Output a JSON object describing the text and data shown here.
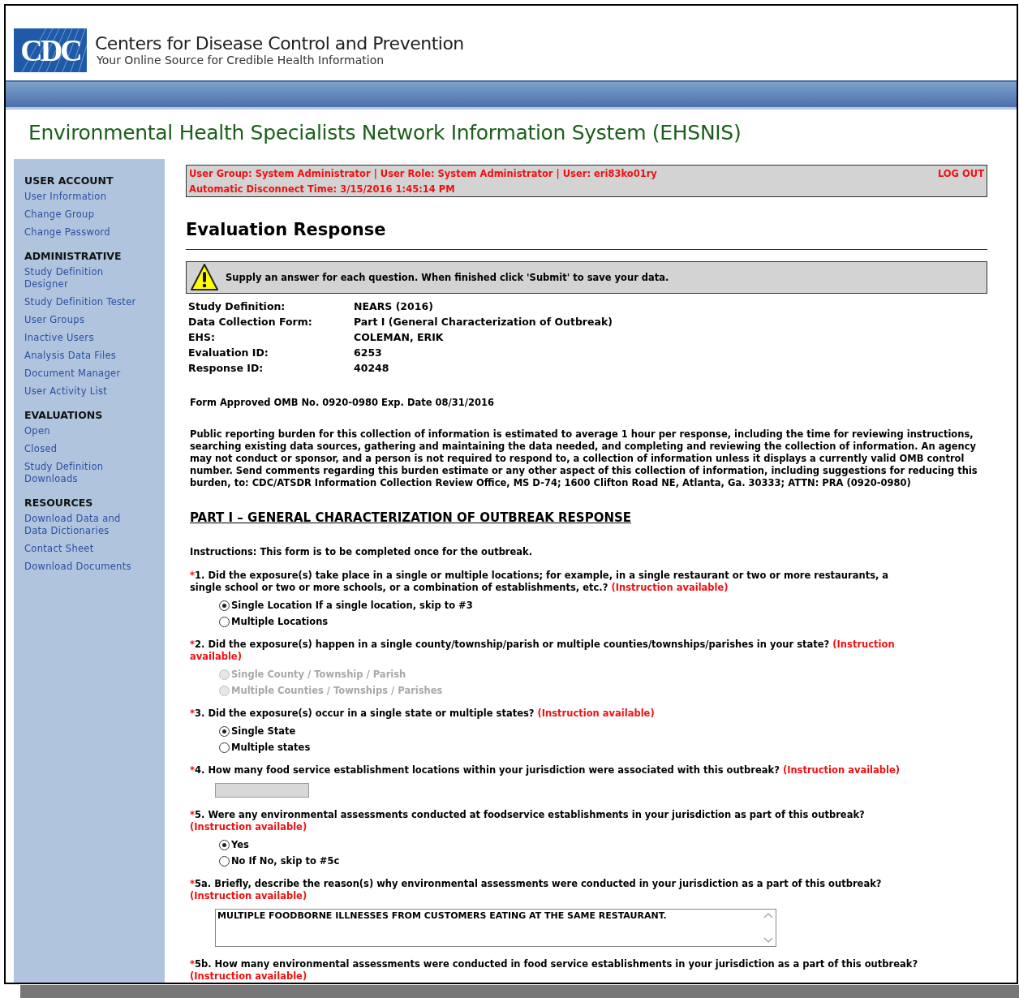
{
  "header": {
    "logo_text": "CDC",
    "title": "Centers for Disease Control and Prevention",
    "tagline": "Your Online Source for Credible Health Information"
  },
  "app_title": "Environmental Health Specialists Network Information System (EHSNIS)",
  "sidebar": [
    {
      "heading": "USER ACCOUNT",
      "items": [
        {
          "label": "User Information"
        },
        {
          "label": "Change Group"
        },
        {
          "label": "Change Password"
        }
      ]
    },
    {
      "heading": "ADMINISTRATIVE",
      "items": [
        {
          "label": "Study Definition Designer"
        },
        {
          "label": "Study Definition Tester"
        },
        {
          "label": "User Groups"
        },
        {
          "label": "Inactive Users"
        },
        {
          "label": "Analysis Data Files"
        },
        {
          "label": "Document Manager"
        },
        {
          "label": "User Activity List"
        }
      ]
    },
    {
      "heading": "EVALUATIONS",
      "items": [
        {
          "label": "Open"
        },
        {
          "label": "Closed"
        },
        {
          "label": "Study Definition Downloads"
        }
      ]
    },
    {
      "heading": "RESOURCES",
      "items": [
        {
          "label": "Download Data and Data Dictionaries"
        },
        {
          "label": "Contact Sheet"
        },
        {
          "label": "Download Documents"
        }
      ]
    }
  ],
  "status": {
    "user_line": "User Group: System Administrator | User Role: System Administrator | User: eri83ko01ry",
    "disconnect": "Automatic Disconnect Time: 3/15/2016 1:45:14 PM",
    "logout": "LOG OUT"
  },
  "page_title": "Evaluation Response",
  "notice": "Supply an answer for each question. When finished click 'Submit' to save your data.",
  "info": [
    {
      "label": "Study Definition:",
      "value": "NEARS (2016)"
    },
    {
      "label": "Data Collection Form:",
      "value": "Part I (General Characterization of Outbreak)"
    },
    {
      "label": "EHS:",
      "value": "COLEMAN, ERIK"
    },
    {
      "label": "Evaluation ID:",
      "value": "6253"
    },
    {
      "label": "Response ID:",
      "value": "40248"
    }
  ],
  "omb": "Form Approved OMB No. 0920-0980 Exp. Date 08/31/2016",
  "burden": "Public reporting burden for this collection of information is estimated to average 1 hour per response, including the time for reviewing instructions, searching existing data sources, gathering and maintaining the data needed, and completing and reviewing the collection of information. An agency may not conduct or sponsor, and a person is not required to respond to, a collection of information unless it displays a currently valid OMB control number. Send comments regarding this burden estimate or any other aspect of this collection of information, including suggestions for reducing this burden, to: CDC/ATSDR Information Collection Review Office, MS D-74; 1600 Clifton Road NE, Atlanta, Ga. 30333; ATTN: PRA (0920-0980)",
  "part_title": "PART I – GENERAL CHARACTERIZATION OF OUTBREAK RESPONSE",
  "instructions": "Instructions: This form is to be completed once for the outbreak.",
  "questions": [
    {
      "kind": "radio",
      "mark": "*",
      "text": "1. Did the exposure(s) take place in a single or multiple locations; for example, in a single restaurant or two or more restaurants, a single school or two or more schools, or a combination of establishments, etc.?",
      "instruction": "(Instruction available)",
      "options": [
        {
          "label": "Single Location If a single location, skip to #3",
          "selected": true,
          "disabled": false
        },
        {
          "label": "Multiple Locations",
          "selected": false,
          "disabled": false
        }
      ]
    },
    {
      "kind": "radio",
      "mark": "*",
      "text": "2. Did the exposure(s) happen in a single county/township/parish or multiple counties/townships/parishes in your state?",
      "instruction": "(Instruction available)",
      "options": [
        {
          "label": "Single County / Township / Parish",
          "selected": false,
          "disabled": true
        },
        {
          "label": "Multiple Counties / Townships / Parishes",
          "selected": false,
          "disabled": true
        }
      ]
    },
    {
      "kind": "radio",
      "mark": "*",
      "text": "3. Did the exposure(s) occur in a single state or multiple states?",
      "instruction": "(Instruction available)",
      "options": [
        {
          "label": "Single State",
          "selected": true,
          "disabled": false
        },
        {
          "label": "Multiple states",
          "selected": false,
          "disabled": false
        }
      ]
    },
    {
      "kind": "text",
      "mark": "*",
      "text": "4. How many food service establishment locations within your jurisdiction were associated with this outbreak?",
      "instruction": "(Instruction available)",
      "disabled": true
    },
    {
      "kind": "radio",
      "mark": "*",
      "text": "5. Were any environmental assessments conducted at foodservice establishments in your jurisdiction as part of this outbreak?",
      "instruction": "(Instruction available)",
      "options": [
        {
          "label": "Yes",
          "selected": true,
          "disabled": false
        },
        {
          "label": "No If No, skip to #5c",
          "selected": false,
          "disabled": false
        }
      ]
    },
    {
      "kind": "textarea",
      "mark": "*",
      "text": "5a. Briefly, describe the reason(s) why environmental assessments were conducted in your jurisdiction as a part of this outbreak?",
      "instruction": "(Instruction available)",
      "value": "MULTIPLE FOODBORNE ILLNESSES FROM CUSTOMERS EATING AT THE SAME RESTAURANT."
    },
    {
      "kind": "label",
      "mark": "*",
      "text": "5b. How many environmental assessments were conducted in food service establishments in your jurisdiction as a part of this outbreak?",
      "instruction": "(Instruction available)"
    }
  ]
}
